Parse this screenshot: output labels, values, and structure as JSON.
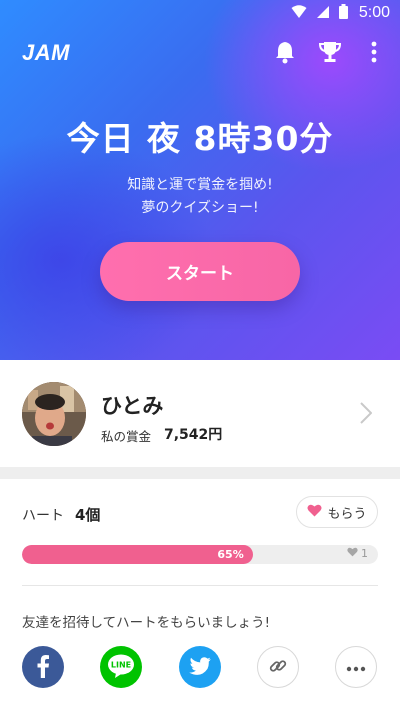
{
  "status_bar": {
    "time": "5:00"
  },
  "app": {
    "logo": "JAM"
  },
  "hero": {
    "title": "今日 夜 8時30分",
    "subtitle_line1": "知識と運で賞金を掴め!",
    "subtitle_line2": "夢のクイズショー!",
    "start_label": "スタート"
  },
  "profile": {
    "name": "ひとみ",
    "prize_label": "私の賞金",
    "prize_value": "7,542円"
  },
  "hearts": {
    "label": "ハート",
    "count": "4個",
    "get_label": "もらう",
    "progress_percent_text": "65%",
    "progress_fraction": 0.65,
    "progress_cap": "1"
  },
  "invite": {
    "text": "友達を招待してハートをもらいましょう!",
    "share_icons": [
      "facebook-icon",
      "line-icon",
      "twitter-icon",
      "link-icon",
      "more-icon"
    ]
  },
  "colors": {
    "accent_pink": "#f0608f",
    "facebook": "#3b5998",
    "line": "#00c300",
    "twitter": "#1da1f2"
  }
}
